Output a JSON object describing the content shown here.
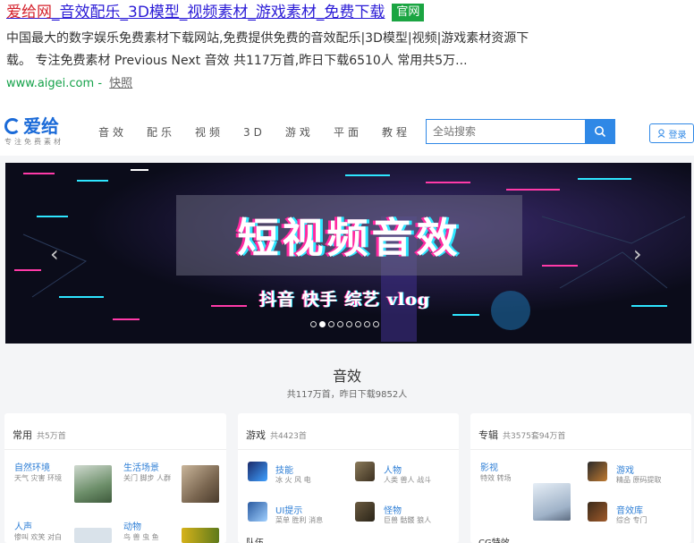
{
  "result": {
    "title_highlight": "爱给网",
    "title_rest": "_音效配乐_3D模型_视频素材_游戏素材_免费下载",
    "badge": "官网",
    "desc_line1": "中国最大的数字娱乐免费素材下载网站,免费提供免费的音效配乐|3D模型|视频|游戏素材资源下",
    "desc_line2": "载。 专注免费素材 Previous Next 音效 共117万首,昨日下载6510人 常用共5万...",
    "url": "www.aigei.com",
    "sep": "-",
    "snapshot": "快照"
  },
  "site": {
    "logo_text": "爱给",
    "logo_sub": "专注免费素材",
    "nav": [
      "音效",
      "配乐",
      "视频",
      "3D",
      "游戏",
      "平面",
      "教程"
    ],
    "search_placeholder": "全站搜索",
    "login": "登录",
    "banner": {
      "title": "短视频音效",
      "tags": "抖音 快手 综艺 vlog",
      "dots": 8,
      "active_dot": 1
    },
    "section": {
      "title": "音效",
      "sub": "共117万首，昨日下载9852人"
    },
    "cards": [
      {
        "title": "常用",
        "count": "共5万首",
        "items": [
          {
            "title": "自然环境",
            "sub": "天气 灾害 环境"
          },
          {
            "title": "生活场景",
            "sub": "关门 脚步 人群"
          },
          {
            "title": "人声",
            "sub": "惨叫 欢笑 对白"
          },
          {
            "title": "动物",
            "sub": "鸟 兽 虫 鱼"
          }
        ]
      },
      {
        "title": "游戏",
        "count": "共4423首",
        "items": [
          {
            "title": "技能",
            "sub": "冰 火 风 电"
          },
          {
            "title": "人物",
            "sub": "人类 兽人 战斗"
          },
          {
            "title": "UI提示",
            "sub": "菜单 胜利 消息"
          },
          {
            "title": "怪物",
            "sub": "巨兽 骷髅 狼人"
          }
        ],
        "more": "队伍"
      },
      {
        "title": "专辑",
        "count": "共3575套94万首",
        "items": [
          {
            "title": "影视",
            "sub": "特效 转场"
          },
          {
            "title": "游戏",
            "sub": "精品 原码提取"
          },
          {
            "title": "音效库",
            "sub": "综合 专门"
          }
        ],
        "more": "CG特效"
      }
    ]
  },
  "colors": {
    "accent": "#2f88e6",
    "link": "#2a1bd6",
    "highlight": "#d4202b",
    "url_green": "#15a24a"
  }
}
